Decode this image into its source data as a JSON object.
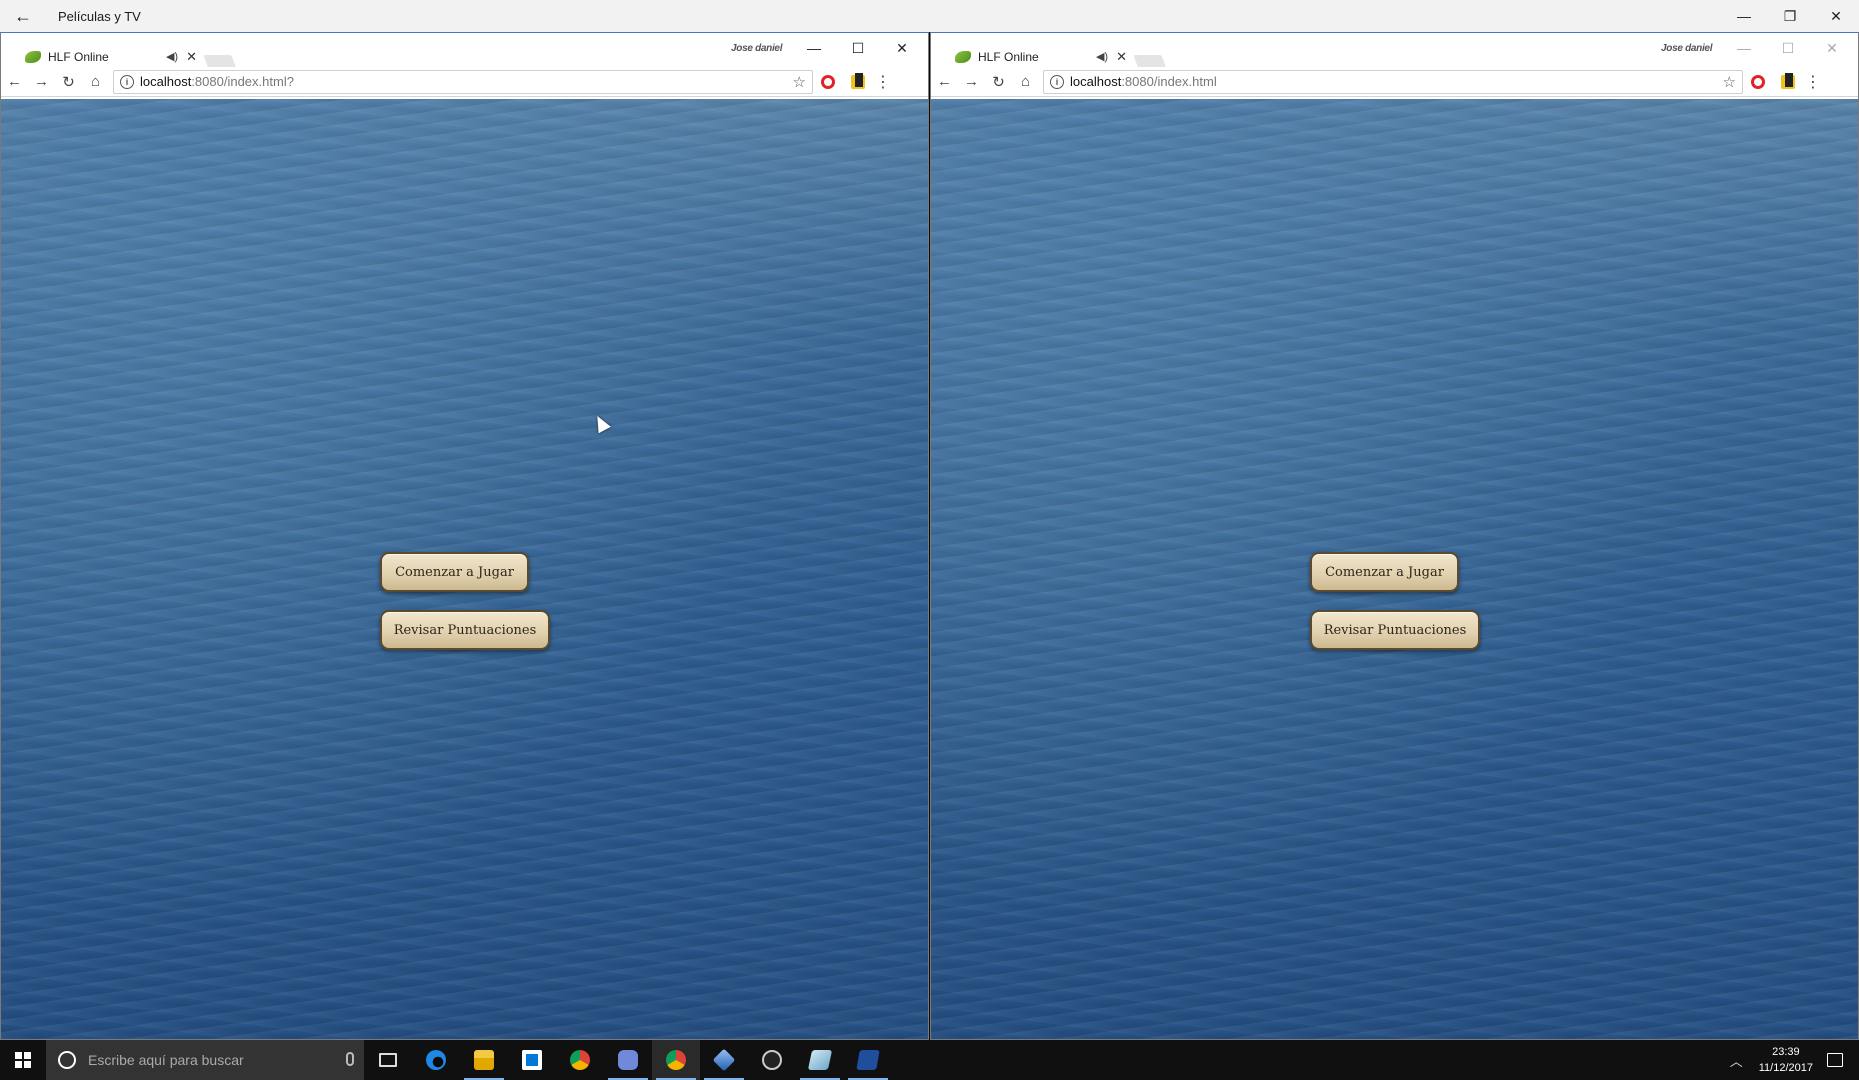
{
  "app": {
    "title": "Películas y TV",
    "back_icon": "←",
    "minimize": "—",
    "restore": "❐",
    "close": "✕"
  },
  "browsers": [
    {
      "tab_title": "HLF Online",
      "profile_name": "Jose daniel",
      "url_host": "localhost",
      "url_path": ":8080/index.html?",
      "buttons": {
        "start": "Comenzar a Jugar",
        "scores": "Revisar Puntuaciones"
      }
    },
    {
      "tab_title": "HLF Online",
      "profile_name": "Jose daniel",
      "url_host": "localhost",
      "url_path": ":8080/index.html",
      "buttons": {
        "start": "Comenzar a Jugar",
        "scores": "Revisar Puntuaciones"
      }
    }
  ],
  "taskbar": {
    "search_placeholder": "Escribe aquí para buscar",
    "time": "23:39",
    "date": "11/12/2017"
  },
  "icons": {
    "taskbar": [
      "task-view-icon",
      "edge-icon",
      "file-explorer-icon",
      "store-icon",
      "chrome-icon",
      "discord-icon",
      "chrome-active-icon",
      "virtualbox-icon",
      "obs-icon",
      "app-icon",
      "powershell-icon"
    ]
  }
}
